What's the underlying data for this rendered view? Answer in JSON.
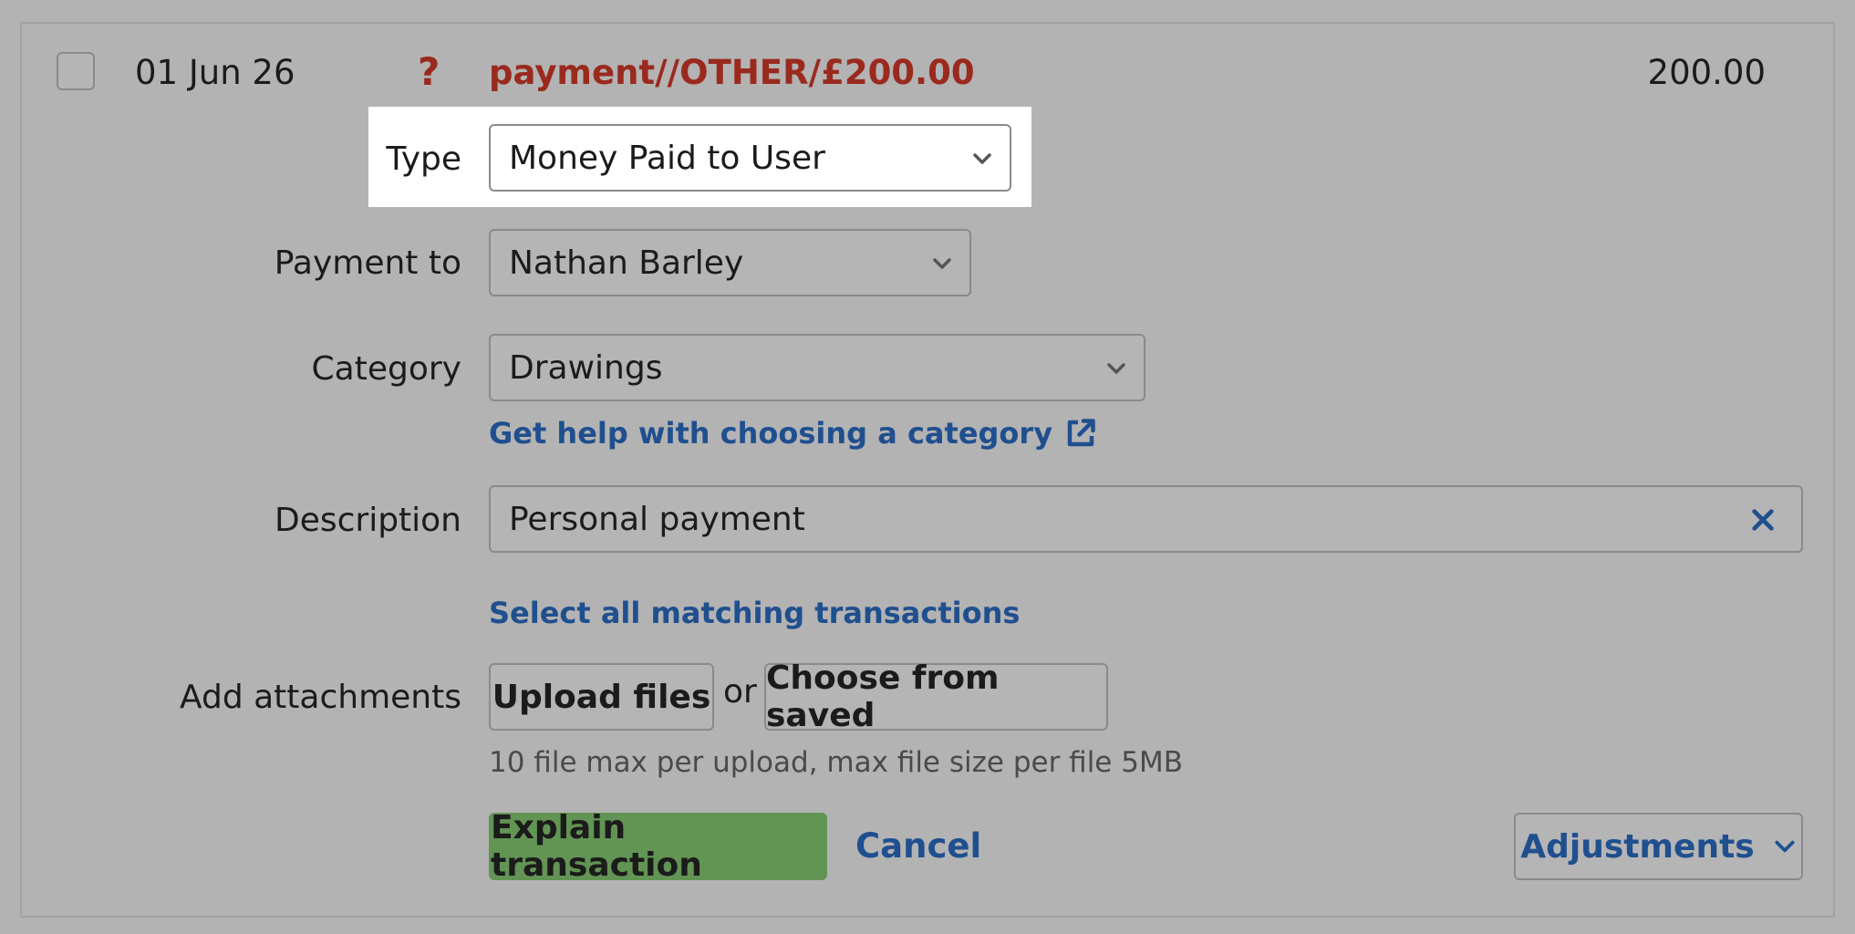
{
  "transaction": {
    "date": "01 Jun 26",
    "status_symbol": "?",
    "reference": "payment//OTHER/£200.00",
    "amount": "200.00"
  },
  "form": {
    "type": {
      "label": "Type",
      "value": "Money Paid to User"
    },
    "payment_to": {
      "label": "Payment to",
      "value": "Nathan Barley"
    },
    "category": {
      "label": "Category",
      "value": "Drawings",
      "help_link": "Get help with choosing a category"
    },
    "description": {
      "label": "Description",
      "value": "Personal payment"
    },
    "select_matching": "Select all matching transactions",
    "attachments": {
      "label": "Add attachments",
      "upload": "Upload files",
      "or": "or",
      "choose_saved": "Choose from saved",
      "hint": "10 file max per upload, max file size per file 5MB"
    },
    "actions": {
      "explain": "Explain transaction",
      "cancel": "Cancel",
      "adjustments": "Adjustments"
    }
  },
  "colors": {
    "accent_link": "#1f4f8f",
    "primary_button": "#629453",
    "alert_red": "#9a2a1e"
  }
}
